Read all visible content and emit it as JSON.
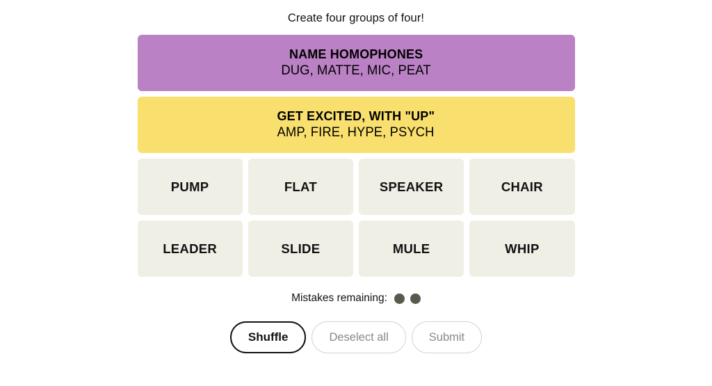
{
  "game": {
    "headline": "Create four groups of four!",
    "solved_groups": [
      {
        "title": "NAME HOMOPHONES",
        "words": "DUG, MATTE, MIC, PEAT",
        "color": "#ba81c5"
      },
      {
        "title": "GET EXCITED, WITH \"UP\"",
        "words": "AMP, FIRE, HYPE, PSYCH",
        "color": "#f9df6d"
      }
    ],
    "tile_rows": [
      [
        "PUMP",
        "FLAT",
        "SPEAKER",
        "CHAIR"
      ],
      [
        "LEADER",
        "SLIDE",
        "MULE",
        "WHIP"
      ]
    ],
    "mistakes": {
      "label": "Mistakes remaining:",
      "remaining": 2,
      "dot_color": "#5a594e"
    },
    "controls": [
      {
        "label": "Shuffle",
        "state": "enabled"
      },
      {
        "label": "Deselect all",
        "state": "disabled"
      },
      {
        "label": "Submit",
        "state": "disabled"
      }
    ],
    "tile_color": "#efefe6"
  }
}
